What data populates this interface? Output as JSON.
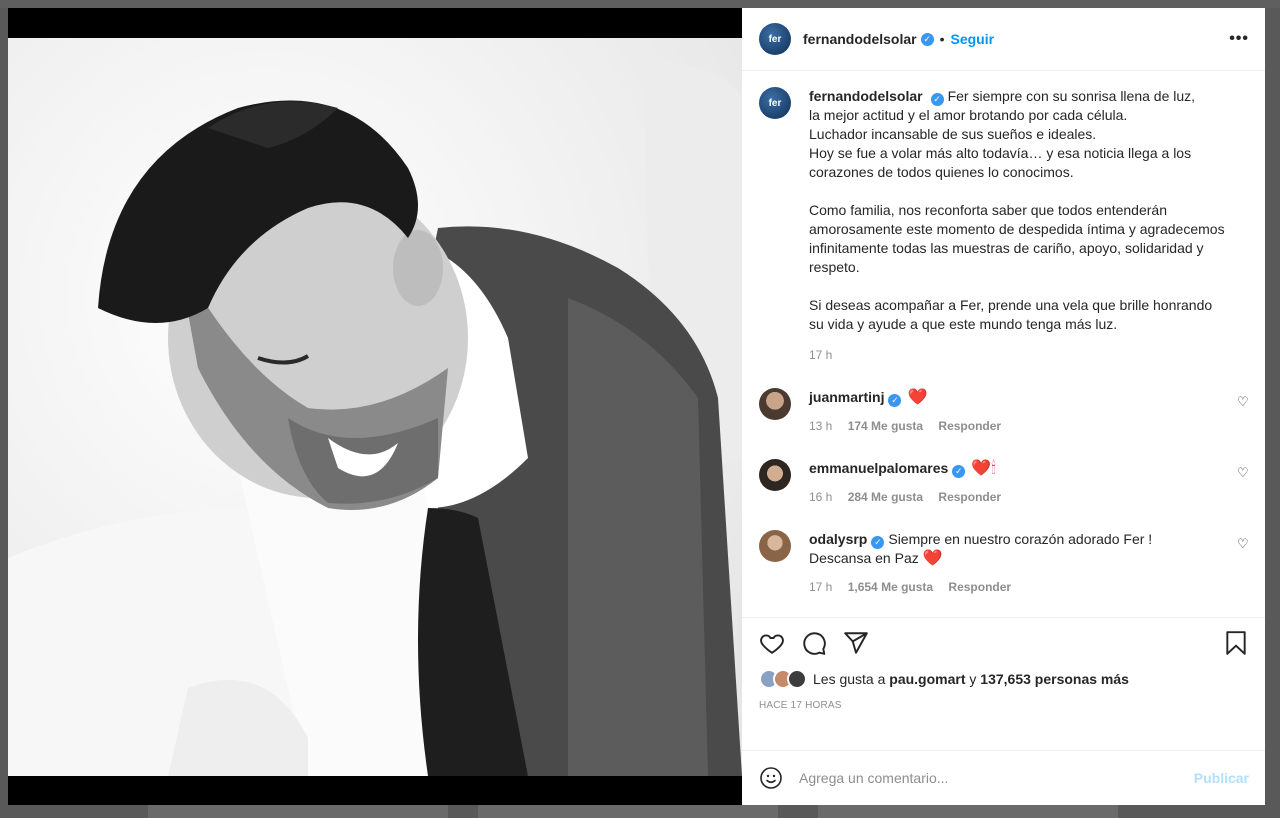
{
  "post": {
    "author": "fernandodelsolar",
    "author_avatar_text": "fer",
    "follow_label": "Seguir",
    "separator": "•",
    "more_label": "•••",
    "caption_lines": [
      "Fer siempre con su sonrisa llena de luz,",
      "la mejor actitud y el amor brotando por cada célula.",
      "Luchador incansable de sus sueños e ideales.",
      "Hoy se fue a volar más alto todavía… y esa noticia llega a los corazones de todos quienes lo conocimos.",
      "",
      "Como familia, nos reconforta saber que todos entenderán amorosamente este momento de despedida íntima y agradecemos infinitamente todas las muestras de cariño, apoyo, solidaridad y respeto.",
      "",
      "Si deseas acompañar a Fer, prende una vela que brille honrando su vida y ayude a que este mundo tenga más luz."
    ],
    "caption_time": "17 h"
  },
  "comments": [
    {
      "user": "juanmartinj",
      "text": "",
      "emoji": "❤️",
      "time": "13 h",
      "likes": "174 Me gusta",
      "reply": "Responder"
    },
    {
      "user": "emmanuelpalomares",
      "text": "",
      "emoji": "❤️🕯",
      "time": "16 h",
      "likes": "284 Me gusta",
      "reply": "Responder"
    },
    {
      "user": "odalysrp",
      "text": "Siempre en nuestro corazón adorado Fer ! Descansa en Paz",
      "emoji": "❤️",
      "time": "17 h",
      "likes": "1,654 Me gusta",
      "reply": "Responder"
    }
  ],
  "likes_line": {
    "prefix": "Les gusta a",
    "user": "pau.gomart",
    "joiner": "y",
    "others": "137,653 personas más"
  },
  "timestamp": "HACE 17 HORAS",
  "add_comment": {
    "placeholder": "Agrega un comentario...",
    "publish_label": "Publicar"
  },
  "colors": {
    "accent": "#0095f6",
    "publish_disabled": "#b2dffc",
    "verified": "#3897f0",
    "muted": "#8e8e8e"
  },
  "icons": [
    "heart-icon",
    "comment-icon",
    "share-icon",
    "bookmark-icon",
    "emoji-icon",
    "verified-icon",
    "more-icon"
  ]
}
